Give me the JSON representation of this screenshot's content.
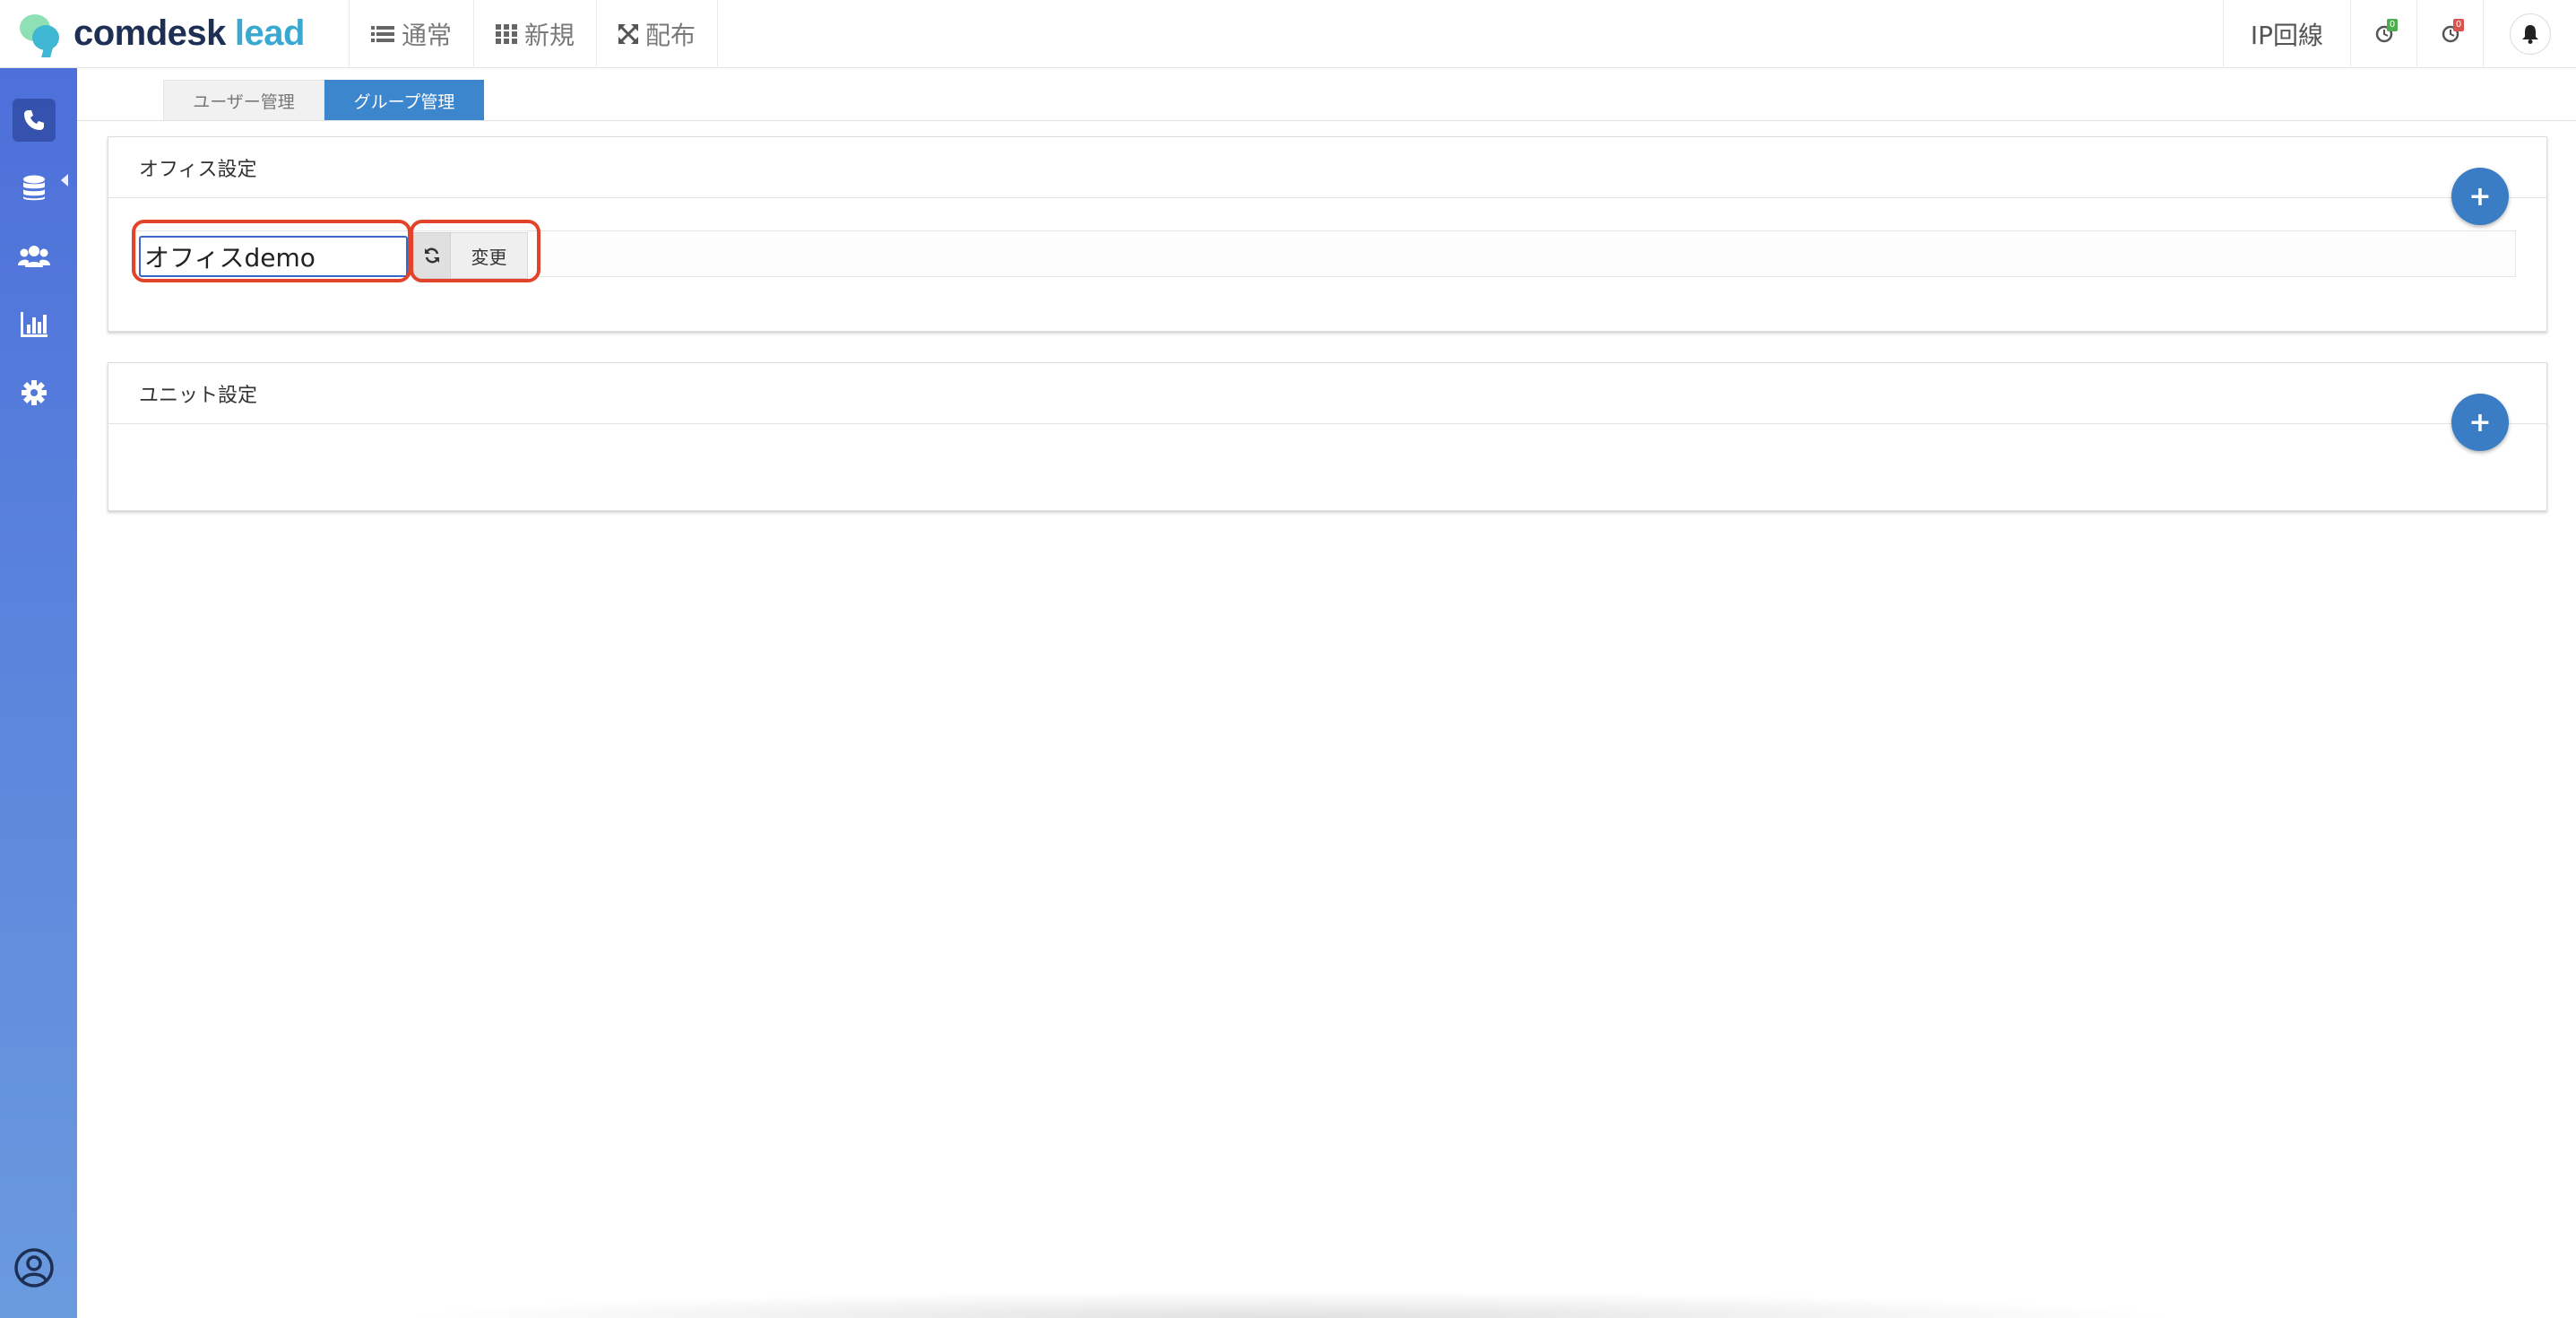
{
  "app": {
    "brand_part1": "comdesk",
    "brand_part2": "lead",
    "colors": {
      "sidebar": "#4d6fda",
      "accent": "#3b86cc",
      "highlight_ring": "#e1442b"
    }
  },
  "top_nav": [
    {
      "label": "通常",
      "icon": "list-icon"
    },
    {
      "label": "新規",
      "icon": "grid-icon"
    },
    {
      "label": "配布",
      "icon": "expand-arrows-icon"
    }
  ],
  "top_right": {
    "ip_line": "IP回線",
    "clock_green_badge": "0",
    "clock_red_badge": "0",
    "bell_icon": "bell-icon"
  },
  "sidebar": {
    "items": [
      {
        "name": "phone",
        "icon": "phone-icon",
        "active": true
      },
      {
        "name": "database",
        "icon": "database-icon"
      },
      {
        "name": "users",
        "icon": "users-icon"
      },
      {
        "name": "reports",
        "icon": "bar-chart-icon"
      },
      {
        "name": "settings",
        "icon": "gear-icon"
      }
    ],
    "profile_icon": "user-circle-icon"
  },
  "tabs": [
    {
      "label": "ユーザー管理",
      "active": false
    },
    {
      "label": "グループ管理",
      "active": true
    }
  ],
  "office_panel": {
    "title": "オフィス設定",
    "input_value": "オフィスdemo",
    "change_button": "変更",
    "add_button": "+"
  },
  "unit_panel": {
    "title": "ユニット設定",
    "add_button": "+"
  }
}
